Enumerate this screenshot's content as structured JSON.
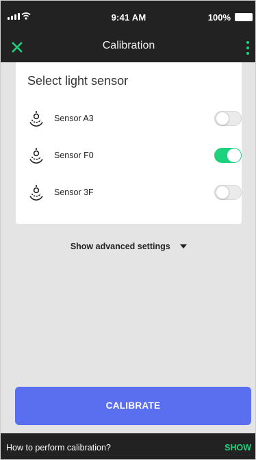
{
  "status_bar": {
    "time": "9:41 AM",
    "battery": "100%"
  },
  "app_bar": {
    "title": "Calibration",
    "close_icon": "close-icon",
    "menu_icon": "more-vertical-icon"
  },
  "sensor_card": {
    "title": "Select light sensor",
    "sensors": [
      {
        "label": "Sensor A3",
        "icon": "light-sensor-icon",
        "enabled": false
      },
      {
        "label": "Sensor F0",
        "icon": "light-sensor-icon",
        "enabled": true
      },
      {
        "label": "Sensor 3F",
        "icon": "light-sensor-icon",
        "enabled": false
      }
    ]
  },
  "advanced": {
    "label": "Show advanced settings",
    "icon": "caret-down-icon"
  },
  "calibrate_button": {
    "label": "CALIBRATE"
  },
  "snackbar": {
    "message": "How to perform calibration?",
    "action": "SHOW"
  },
  "colors": {
    "accent_green": "#1ed17e",
    "primary_blue": "#5a6ff0",
    "dark_bar": "#222222",
    "background": "#e4e4e4"
  }
}
